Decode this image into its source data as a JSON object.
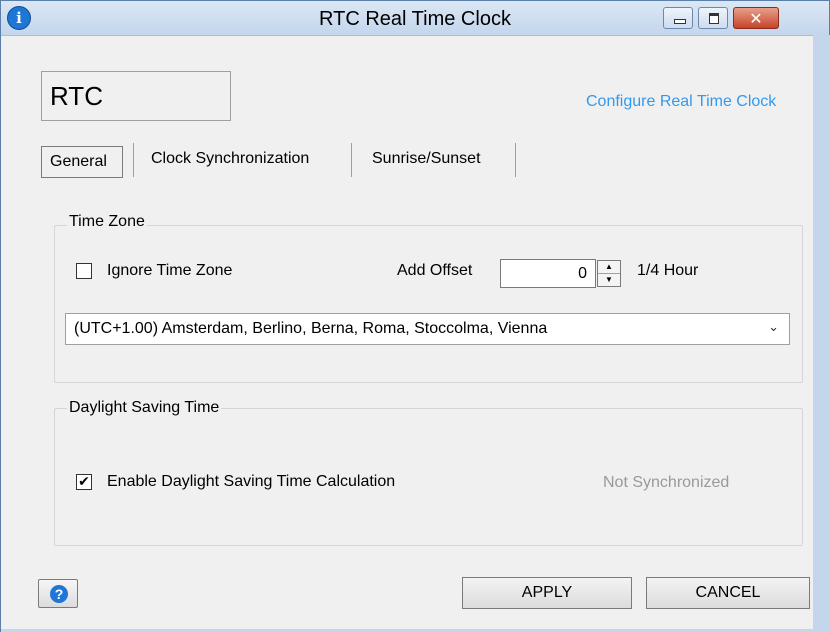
{
  "window": {
    "title": "RTC Real Time Clock",
    "info_icon": "i",
    "close_glyph": "✕"
  },
  "header": {
    "name": "RTC",
    "config_link": "Configure Real Time Clock"
  },
  "tabs": [
    {
      "label": "General",
      "selected": true
    },
    {
      "label": "Clock Synchronization",
      "selected": false
    },
    {
      "label": "Sunrise/Sunset",
      "selected": false
    }
  ],
  "timezone": {
    "group_label": "Time Zone",
    "ignore_label": "Ignore Time Zone",
    "ignore_checked": false,
    "offset_label": "Add Offset",
    "offset_value": "0",
    "offset_unit": "1/4 Hour",
    "selected_zone": "(UTC+1.00) Amsterdam, Berlino, Berna, Roma, Stoccolma, Vienna"
  },
  "dst": {
    "group_label": "Daylight Saving Time",
    "enable_label": "Enable Daylight Saving Time Calculation",
    "enable_checked": true,
    "check_glyph": "✔",
    "status": "Not Synchronized"
  },
  "footer": {
    "help_glyph": "?",
    "apply_label": "APPLY",
    "cancel_label": "CANCEL"
  },
  "colors": {
    "link": "#3399ee",
    "status_muted": "#999999",
    "info_blue": "#1e77d4"
  }
}
